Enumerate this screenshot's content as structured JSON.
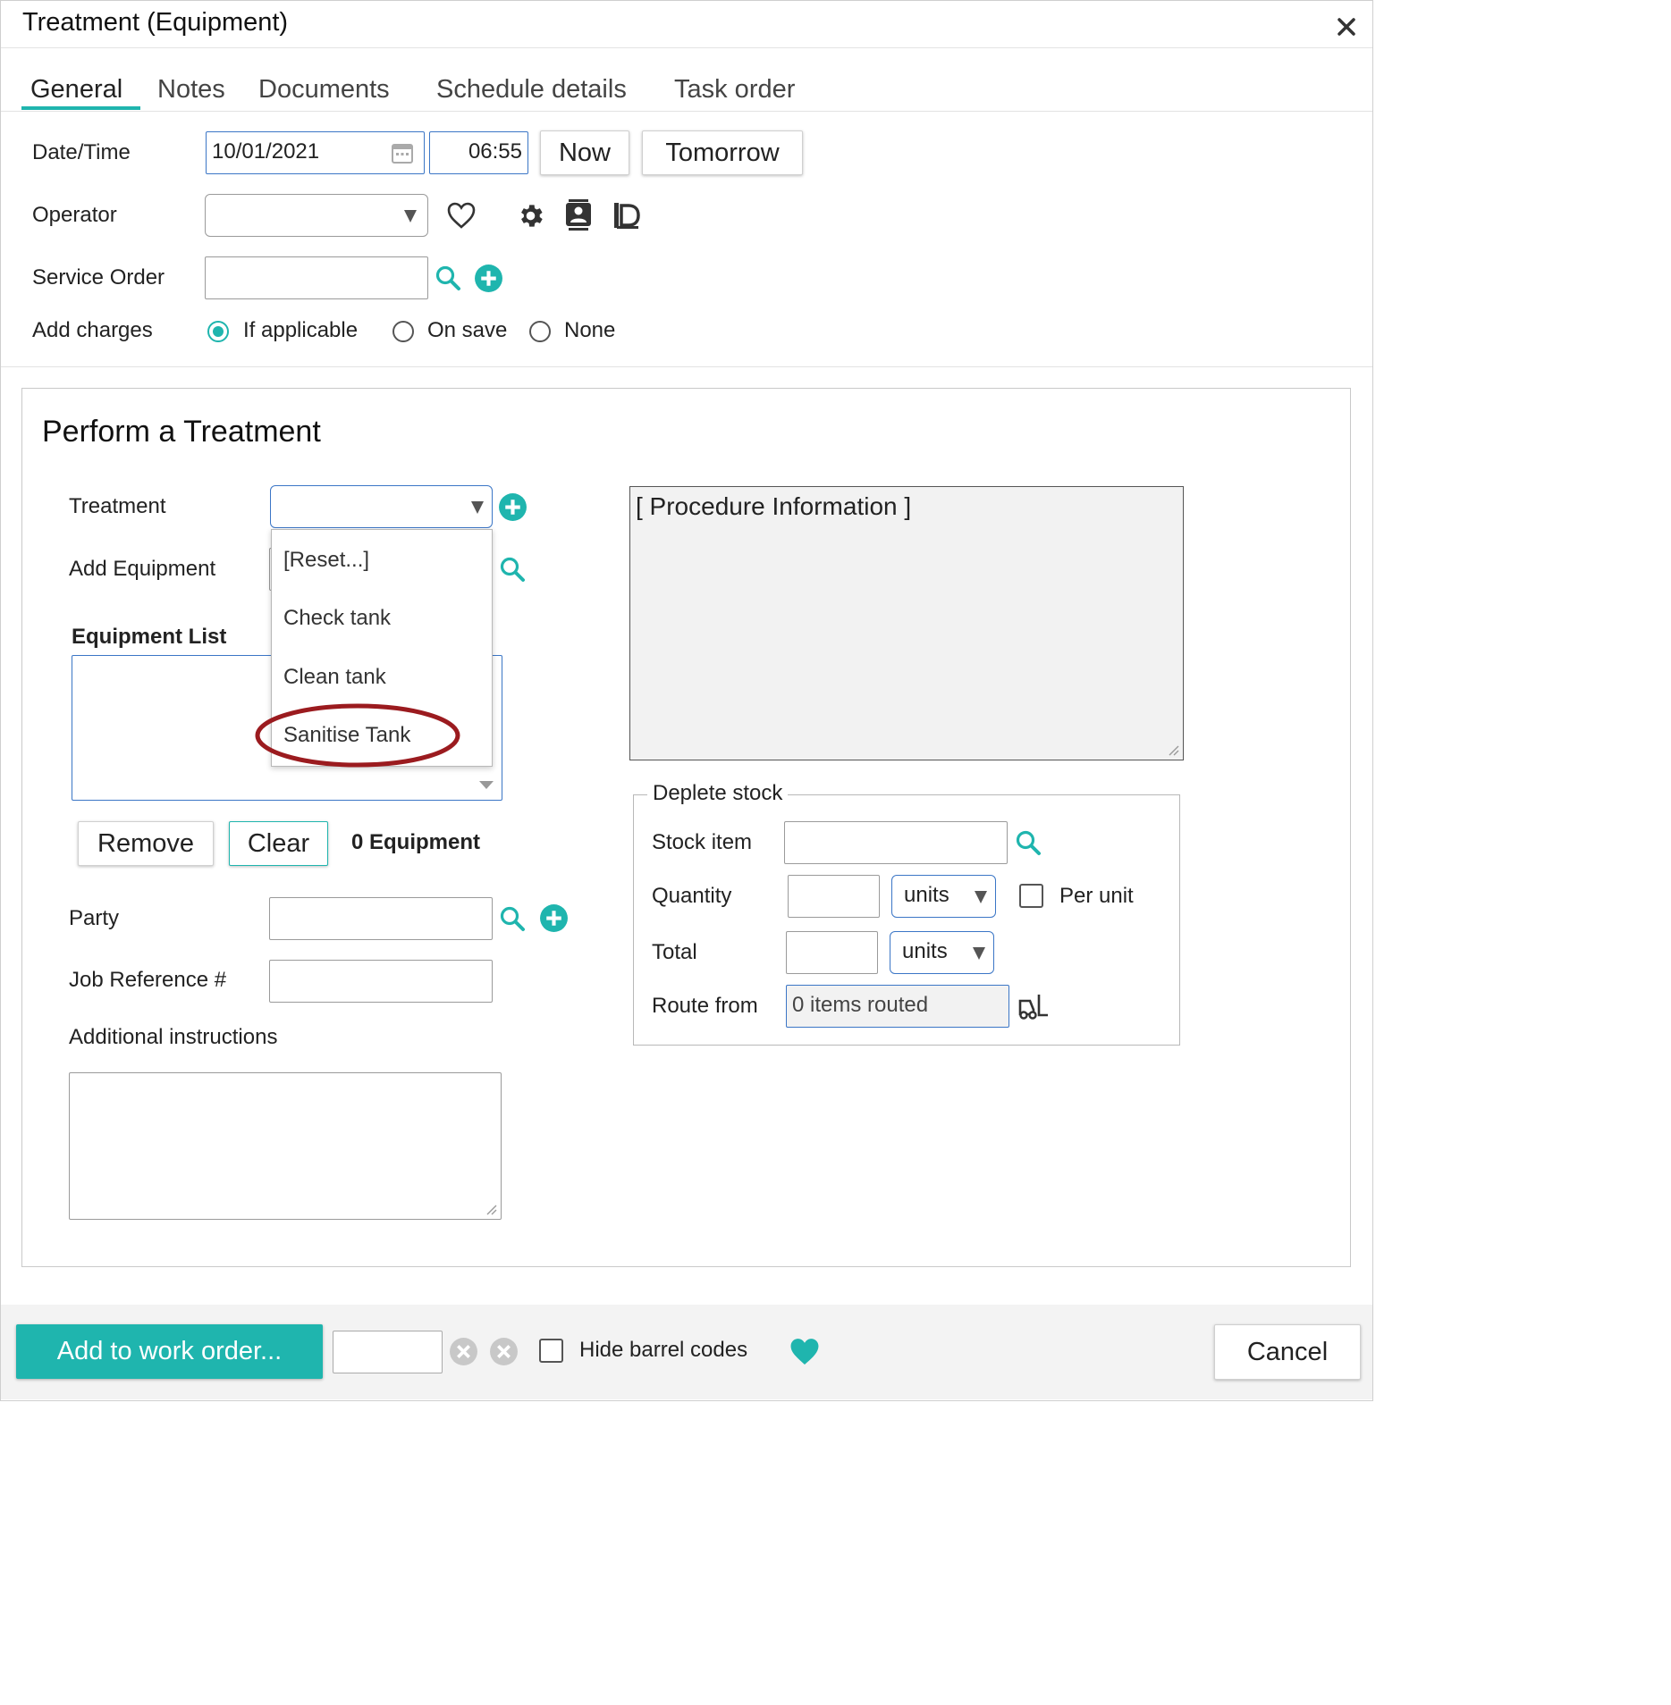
{
  "window": {
    "title": "Treatment (Equipment)"
  },
  "tabs": [
    {
      "label": "General"
    },
    {
      "label": "Notes"
    },
    {
      "label": "Documents"
    },
    {
      "label": "Schedule details"
    },
    {
      "label": "Task order"
    }
  ],
  "general": {
    "datetime_label": "Date/Time",
    "date_value": "10/01/2021",
    "time_value": "06:55",
    "now_label": "Now",
    "tomorrow_label": "Tomorrow",
    "operator_label": "Operator",
    "operator_value": "",
    "service_order_label": "Service Order",
    "service_order_value": "",
    "add_charges_label": "Add charges",
    "charge_options": [
      {
        "label": "If applicable",
        "selected": true
      },
      {
        "label": "On save",
        "selected": false
      },
      {
        "label": "None",
        "selected": false
      }
    ]
  },
  "treatment_section": {
    "title": "Perform a Treatment",
    "treatment_label": "Treatment",
    "treatment_value": "",
    "treatment_options": [
      "[Reset...]",
      "Check tank",
      "Clean tank",
      "Sanitise Tank"
    ],
    "highlighted_option": "Sanitise Tank",
    "add_equipment_label": "Add Equipment",
    "equipment_list_label": "Equipment List",
    "remove_label": "Remove",
    "clear_label": "Clear",
    "equipment_count": "0 Equipment",
    "party_label": "Party",
    "party_value": "",
    "job_reference_label": "Job Reference #",
    "job_reference_value": "",
    "additional_instructions_label": "Additional instructions",
    "additional_instructions_value": "",
    "procedure_info": "[ Procedure Information ]"
  },
  "deplete_stock": {
    "legend": "Deplete stock",
    "stock_item_label": "Stock item",
    "quantity_label": "Quantity",
    "quantity_unit": "units",
    "per_unit_label": "Per unit",
    "total_label": "Total",
    "total_unit": "units",
    "route_from_label": "Route from",
    "route_from_value": "0 items routed"
  },
  "footer": {
    "add_to_work_order_label": "Add to work order...",
    "hide_barrel_codes_label": "Hide barrel codes",
    "cancel_label": "Cancel"
  },
  "colors": {
    "accent": "#1fb5ae",
    "highlight_circle": "#9b1b1f",
    "focus_border": "#3b76c6"
  }
}
